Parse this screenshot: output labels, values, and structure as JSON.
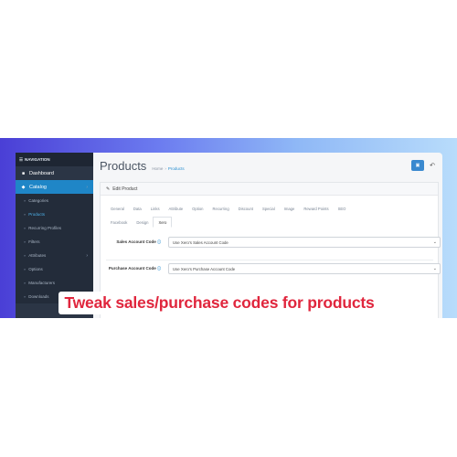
{
  "sidebar": {
    "header": "NAVIGATION",
    "items": [
      {
        "label": "Dashboard",
        "icon": "dashboard-icon",
        "glyph": "■",
        "type": "top"
      },
      {
        "label": "Catalog",
        "icon": "tag-icon",
        "glyph": "◆",
        "type": "active",
        "chevron": "›"
      },
      {
        "label": "Categories",
        "type": "sub"
      },
      {
        "label": "Products",
        "type": "sub",
        "current": true
      },
      {
        "label": "Recurring Profiles",
        "type": "sub"
      },
      {
        "label": "Filters",
        "type": "sub"
      },
      {
        "label": "Attributes",
        "type": "sub",
        "chevron": "›"
      },
      {
        "label": "Options",
        "type": "sub"
      },
      {
        "label": "Manufacturers",
        "type": "sub"
      },
      {
        "label": "Downloads",
        "type": "sub"
      }
    ]
  },
  "header": {
    "title": "Products",
    "breadcrumb": [
      "Home",
      "Products"
    ],
    "separator": "›"
  },
  "panel": {
    "title": "Edit Product"
  },
  "tabs": {
    "row1": [
      "General",
      "Data",
      "Links",
      "Attribute",
      "Option",
      "Recurring",
      "Discount",
      "Special",
      "Image",
      "Reward Points",
      "SEO"
    ],
    "row2": [
      "Facebook",
      "Design",
      "Xero"
    ],
    "active": "Xero"
  },
  "form": {
    "sales_label": "Sales Account Code",
    "sales_value": "Use Xero's Sales Account Code",
    "purchase_label": "Purchase Account Code",
    "purchase_value": "Use Xero's Purchase Account Code"
  },
  "banner": {
    "text": "Tweak sales/purchase codes for products",
    "color": "#e0263d"
  },
  "colors": {
    "accent": "#3a89cf",
    "sidebar_bg": "#2b3545",
    "active_nav": "#1f86c7"
  }
}
